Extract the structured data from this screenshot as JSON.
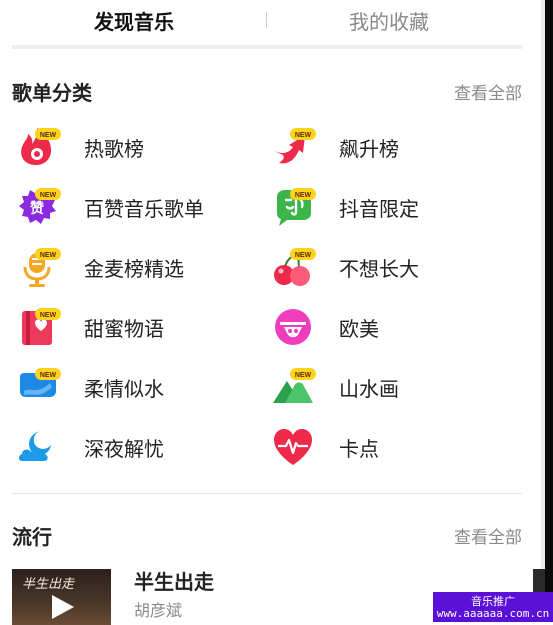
{
  "tabs": {
    "discover": "发现音乐",
    "favorites": "我的收藏"
  },
  "categories_section": {
    "title": "歌单分类",
    "see_all": "查看全部"
  },
  "badge_new": "NEW",
  "categories": [
    {
      "label": "热歌榜",
      "icon": "flame-icon",
      "new": true
    },
    {
      "label": "飙升榜",
      "icon": "rising-arrow-icon",
      "new": true
    },
    {
      "label": "百赞音乐歌单",
      "icon": "like-badge-icon",
      "icon_text": "赞",
      "new": true
    },
    {
      "label": "抖音限定",
      "icon": "chat-bubble-icon",
      "new": true
    },
    {
      "label": "金麦榜精选",
      "icon": "microphone-icon",
      "new": true
    },
    {
      "label": "不想长大",
      "icon": "cherry-icon",
      "new": true
    },
    {
      "label": "甜蜜物语",
      "icon": "heart-book-icon",
      "new": true
    },
    {
      "label": "欧美",
      "icon": "smiley-face-icon",
      "new": false
    },
    {
      "label": "柔情似水",
      "icon": "water-drop-icon",
      "new": true
    },
    {
      "label": "山水画",
      "icon": "mountain-icon",
      "new": true
    },
    {
      "label": "深夜解忧",
      "icon": "moon-cloud-icon",
      "new": false
    },
    {
      "label": "卡点",
      "icon": "heartbeat-icon",
      "new": false
    }
  ],
  "popular_section": {
    "title": "流行",
    "see_all": "查看全部"
  },
  "song": {
    "title": "半生出走",
    "artist": "胡彦斌",
    "cover_text": "半生出走"
  },
  "promo": {
    "line1": "音乐推广",
    "line2": "www.aaaaaa.com.cn"
  },
  "colors": {
    "accent": "#ee2a4a",
    "promo_bg": "#5b10d8",
    "secondary_text": "#8a8a8a"
  }
}
